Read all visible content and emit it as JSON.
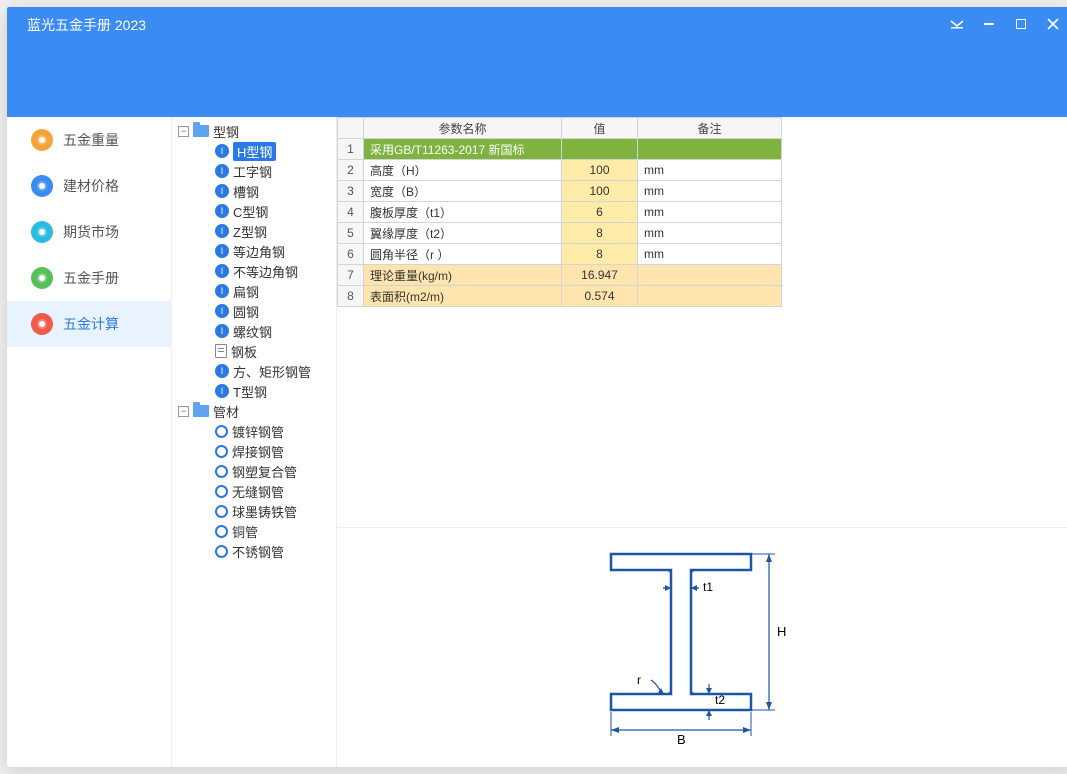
{
  "app": {
    "title": "蓝光五金手册 2023"
  },
  "sidebar": {
    "items": [
      {
        "label": "五金重量",
        "color": "#f8a33a"
      },
      {
        "label": "建材价格",
        "color": "#3b8cf2"
      },
      {
        "label": "期货市场",
        "color": "#2cbce0"
      },
      {
        "label": "五金手册",
        "color": "#56c158"
      },
      {
        "label": "五金计算",
        "color": "#f25b4a"
      }
    ],
    "active_index": 4
  },
  "tree": {
    "groups": [
      {
        "label": "型钢",
        "items": [
          {
            "label": "H型钢",
            "icon": "i",
            "selected": true
          },
          {
            "label": "工字钢",
            "icon": "i"
          },
          {
            "label": "槽钢",
            "icon": "i"
          },
          {
            "label": "C型钢",
            "icon": "i"
          },
          {
            "label": "Z型钢",
            "icon": "i"
          },
          {
            "label": "等边角钢",
            "icon": "i"
          },
          {
            "label": "不等边角钢",
            "icon": "i"
          },
          {
            "label": "扁钢",
            "icon": "i"
          },
          {
            "label": "圆钢",
            "icon": "i"
          },
          {
            "label": "螺纹钢",
            "icon": "i"
          },
          {
            "label": "钢板",
            "icon": "sheet"
          },
          {
            "label": "方、矩形钢管",
            "icon": "i"
          },
          {
            "label": "T型钢",
            "icon": "i"
          }
        ]
      },
      {
        "label": "管材",
        "items": [
          {
            "label": "镀锌钢管",
            "icon": "ring"
          },
          {
            "label": "焊接钢管",
            "icon": "ring"
          },
          {
            "label": "钢塑复合管",
            "icon": "ring"
          },
          {
            "label": "无缝钢管",
            "icon": "ring"
          },
          {
            "label": "球墨铸铁管",
            "icon": "ring"
          },
          {
            "label": "铜管",
            "icon": "ring"
          },
          {
            "label": "不锈钢管",
            "icon": "ring"
          }
        ]
      }
    ]
  },
  "table": {
    "headers": {
      "name": "参数名称",
      "value": "值",
      "note": "备注"
    },
    "rows": [
      {
        "num": "1",
        "name": "采用GB/T11263-2017 新国标",
        "value": "",
        "note": "",
        "style": "green"
      },
      {
        "num": "2",
        "name": "高度（H）",
        "value": "100",
        "note": "mm",
        "style": "yellow"
      },
      {
        "num": "3",
        "name": "宽度（B）",
        "value": "100",
        "note": "mm",
        "style": "yellow"
      },
      {
        "num": "4",
        "name": "腹板厚度（t1）",
        "value": "6",
        "note": "mm",
        "style": "yellow"
      },
      {
        "num": "5",
        "name": "翼缘厚度（t2）",
        "value": "8",
        "note": "mm",
        "style": "yellow"
      },
      {
        "num": "6",
        "name": "圆角半径（r ）",
        "value": "8",
        "note": "mm",
        "style": "yellow"
      },
      {
        "num": "7",
        "name": "理论重量(kg/m)",
        "value": "16.947",
        "note": "",
        "style": "orange"
      },
      {
        "num": "8",
        "name": "表面积(m2/m)",
        "value": "0.574",
        "note": "",
        "style": "orange"
      }
    ]
  },
  "diagram": {
    "B": "B",
    "H": "H",
    "t1": "t1",
    "t2": "t2",
    "r": "r"
  }
}
